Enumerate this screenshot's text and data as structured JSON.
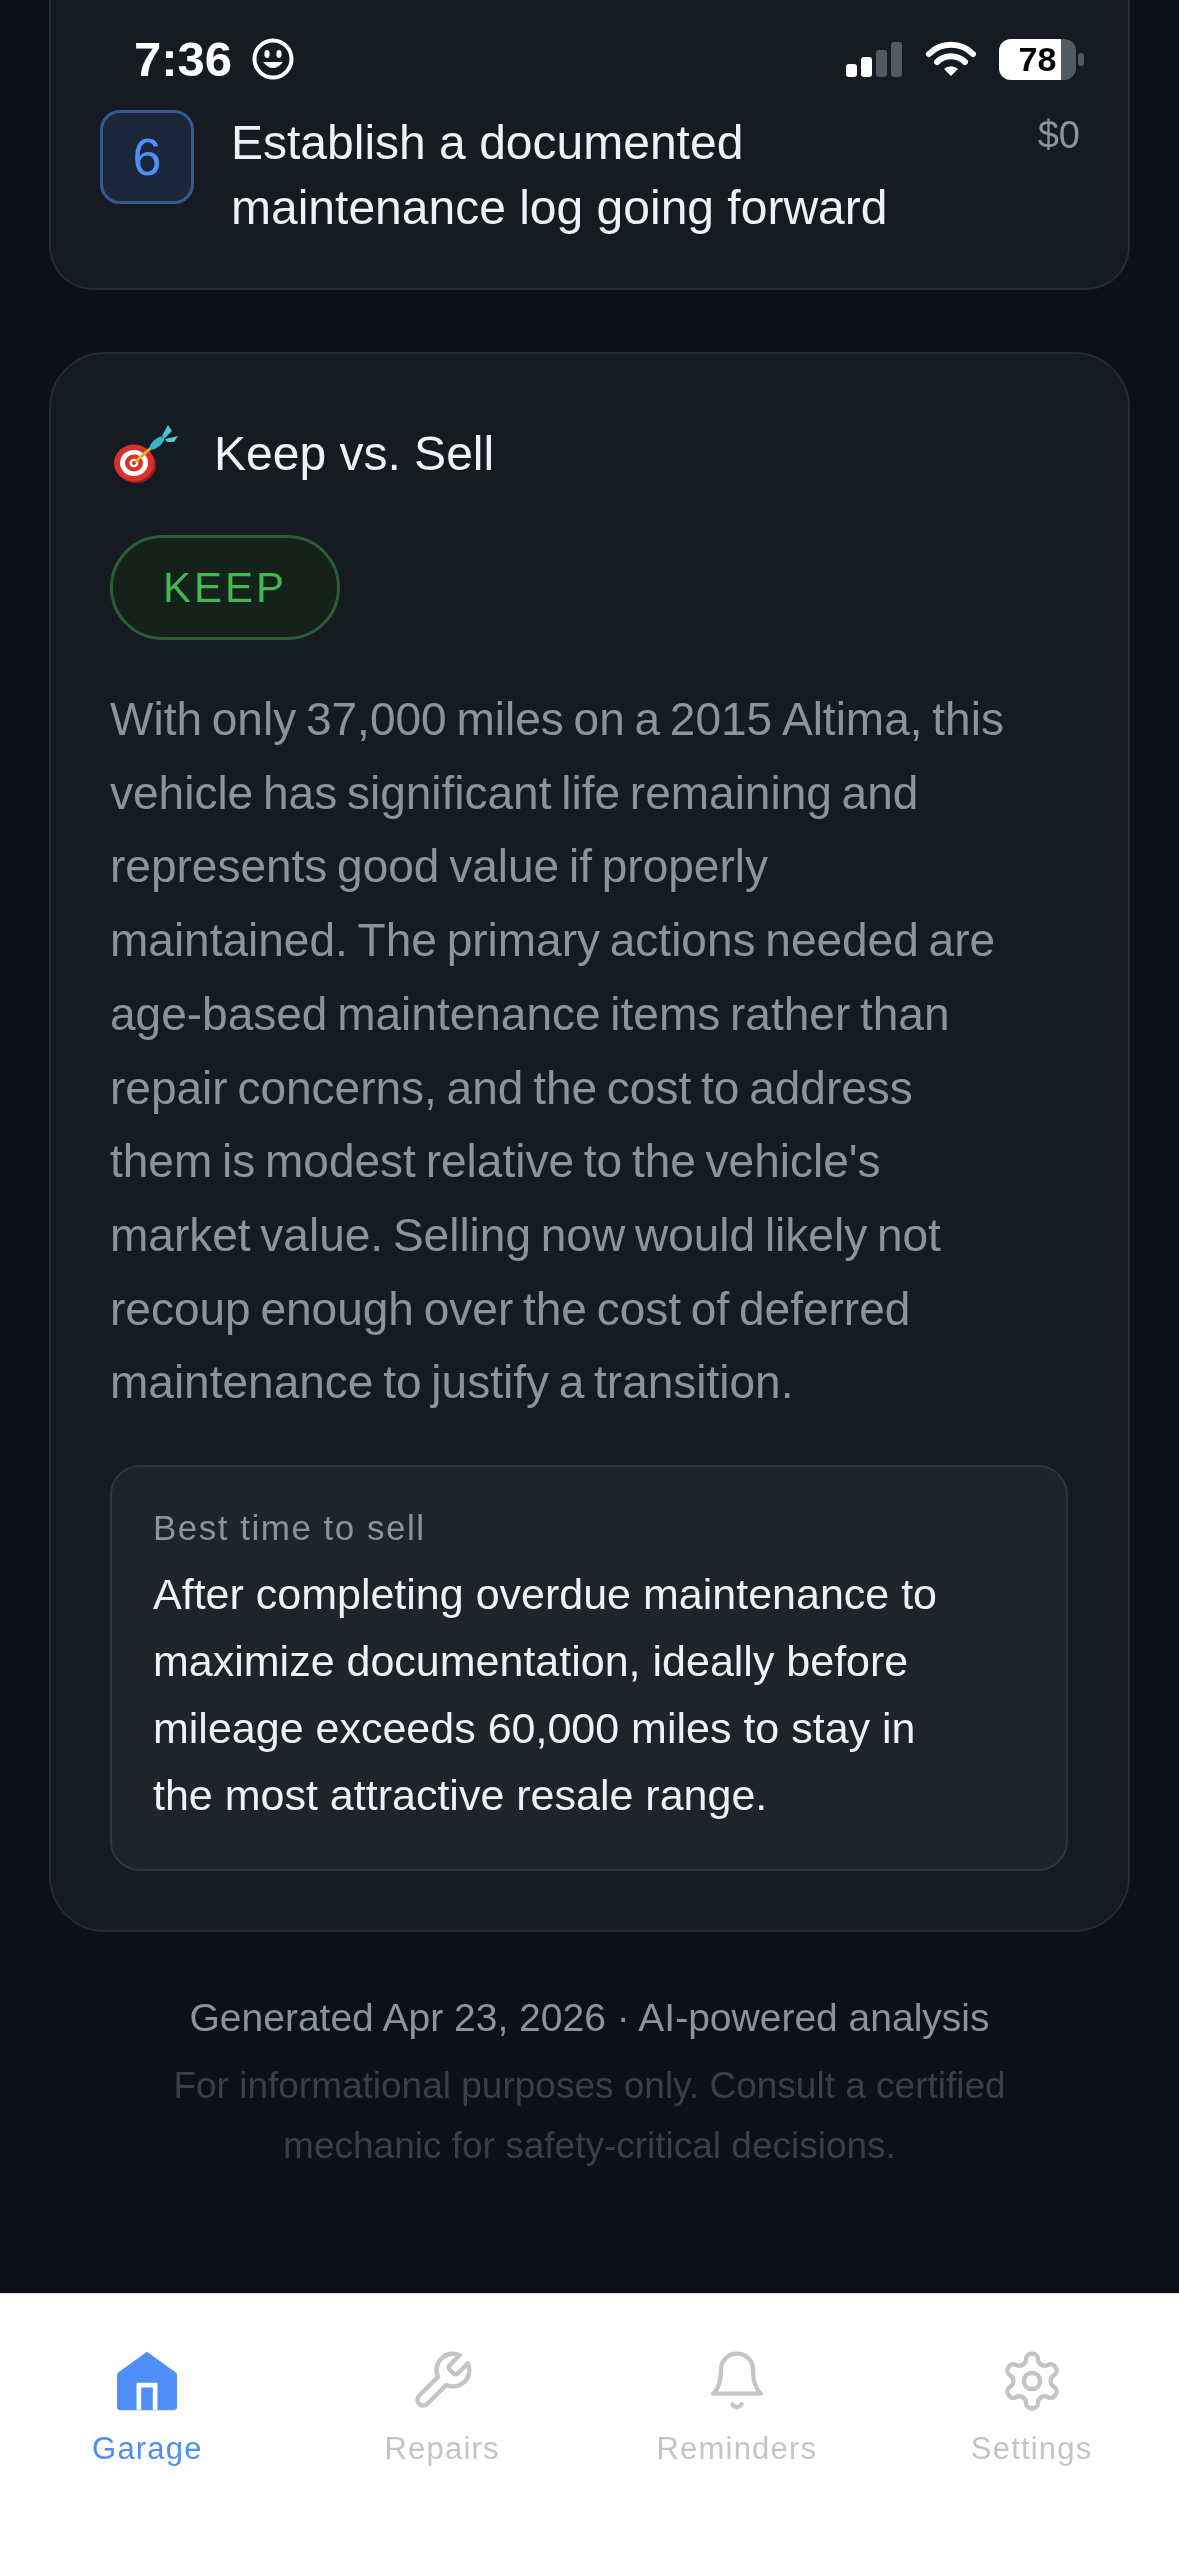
{
  "status_bar": {
    "time": "7:36",
    "battery": "78"
  },
  "action_item": {
    "step": "6",
    "title": "Establish a documented maintenance log going forward",
    "cost": "$0"
  },
  "keep_vs_sell": {
    "title": "Keep vs. Sell",
    "verdict": "KEEP",
    "summary": "With only 37,000 miles on a 2015 Altima, this vehicle has significant life remaining and represents good value if properly maintained. The primary actions needed are age-based maintenance items rather than repair concerns, and the cost to address them is modest relative to the vehicle's market value. Selling now would likely not recoup enough over the cost of deferred maintenance to justify a transition.",
    "best_time": {
      "label": "Best time to sell",
      "text": "After completing overdue maintenance to maximize documentation, ideally before mileage exceeds 60,000 miles to stay in the most attractive resale range."
    }
  },
  "footer": {
    "generated": "Generated Apr 23, 2026 · AI-powered analysis",
    "disclaimer": "For informational purposes only. Consult a certified mechanic for safety-critical decisions."
  },
  "tab_bar": [
    {
      "kind": "garage",
      "label": "Garage",
      "selected": true
    },
    {
      "kind": "repairs",
      "label": "Repairs",
      "selected": false
    },
    {
      "kind": "reminders",
      "label": "Reminders",
      "selected": false
    },
    {
      "kind": "settings",
      "label": "Settings",
      "selected": false
    }
  ]
}
